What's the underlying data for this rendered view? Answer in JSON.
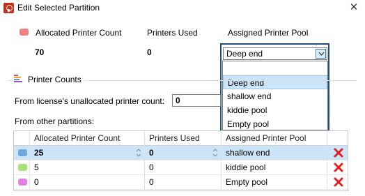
{
  "window": {
    "title": "Edit Selected Partition",
    "close_glyph": "✕"
  },
  "header": {
    "allocated_label": "Allocated Printer Count",
    "used_label": "Printers Used",
    "pool_label": "Assigned Printer Pool",
    "allocated_value": "70",
    "used_value": "0",
    "pool_value": "Deep end",
    "swatch_color": "#f08080"
  },
  "dropdown": {
    "options": [
      "",
      "Deep end",
      "shallow end",
      "kiddie pool",
      "Empty pool"
    ],
    "selected_index": 1
  },
  "printer_counts": {
    "group_title": "Printer Counts",
    "license_label": "From license's unallocated printer count:",
    "license_value": "0",
    "other_label": "From other partitions:",
    "columns": [
      "Allocated Printer Count",
      "Printers Used",
      "Assigned Printer Pool"
    ],
    "rows": [
      {
        "color": "#6fa8dc",
        "allocated": "25",
        "used": "0",
        "pool": "shallow end",
        "selected": true
      },
      {
        "color": "#a5e27a",
        "allocated": "5",
        "used": "0",
        "pool": "kiddie pool",
        "selected": false
      },
      {
        "color": "#e680e0",
        "allocated": "0",
        "used": "0",
        "pool": "Empty pool",
        "selected": false
      }
    ]
  }
}
